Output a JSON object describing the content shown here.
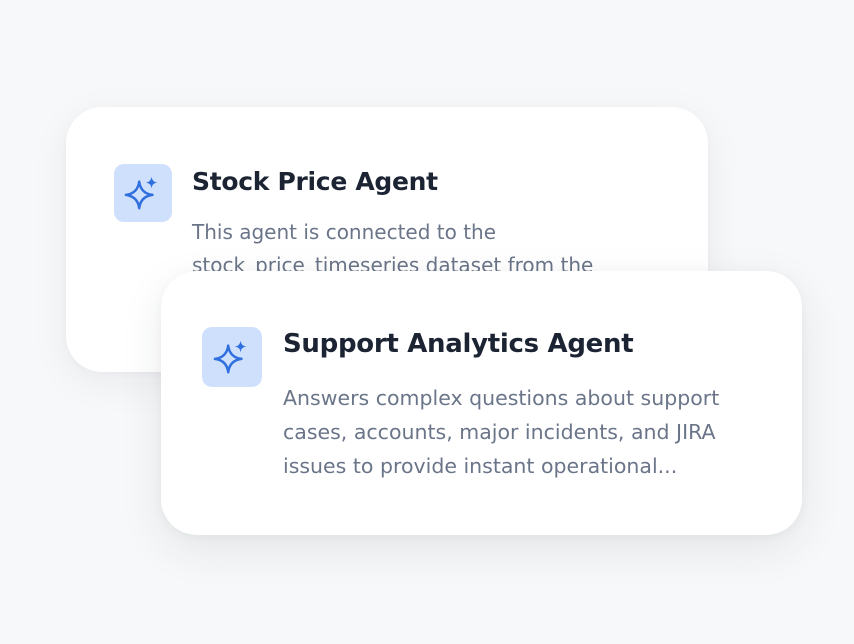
{
  "agents": [
    {
      "name": "Stock Price Agent",
      "description": "This agent is connected to the stock_price_timeseries dataset from the",
      "icon": "sparkle-icon"
    },
    {
      "name": "Support Analytics Agent",
      "description": "Answers complex questions about support cases, accounts, major incidents, and JIRA issues to provide instant operational...",
      "icon": "sparkle-icon"
    }
  ],
  "colors": {
    "background": "#f7f8f9",
    "card": "#ffffff",
    "icon_tile": "#cfe0fd",
    "icon": "#2f6fde",
    "title": "#1c2433",
    "description": "#6b7589"
  }
}
